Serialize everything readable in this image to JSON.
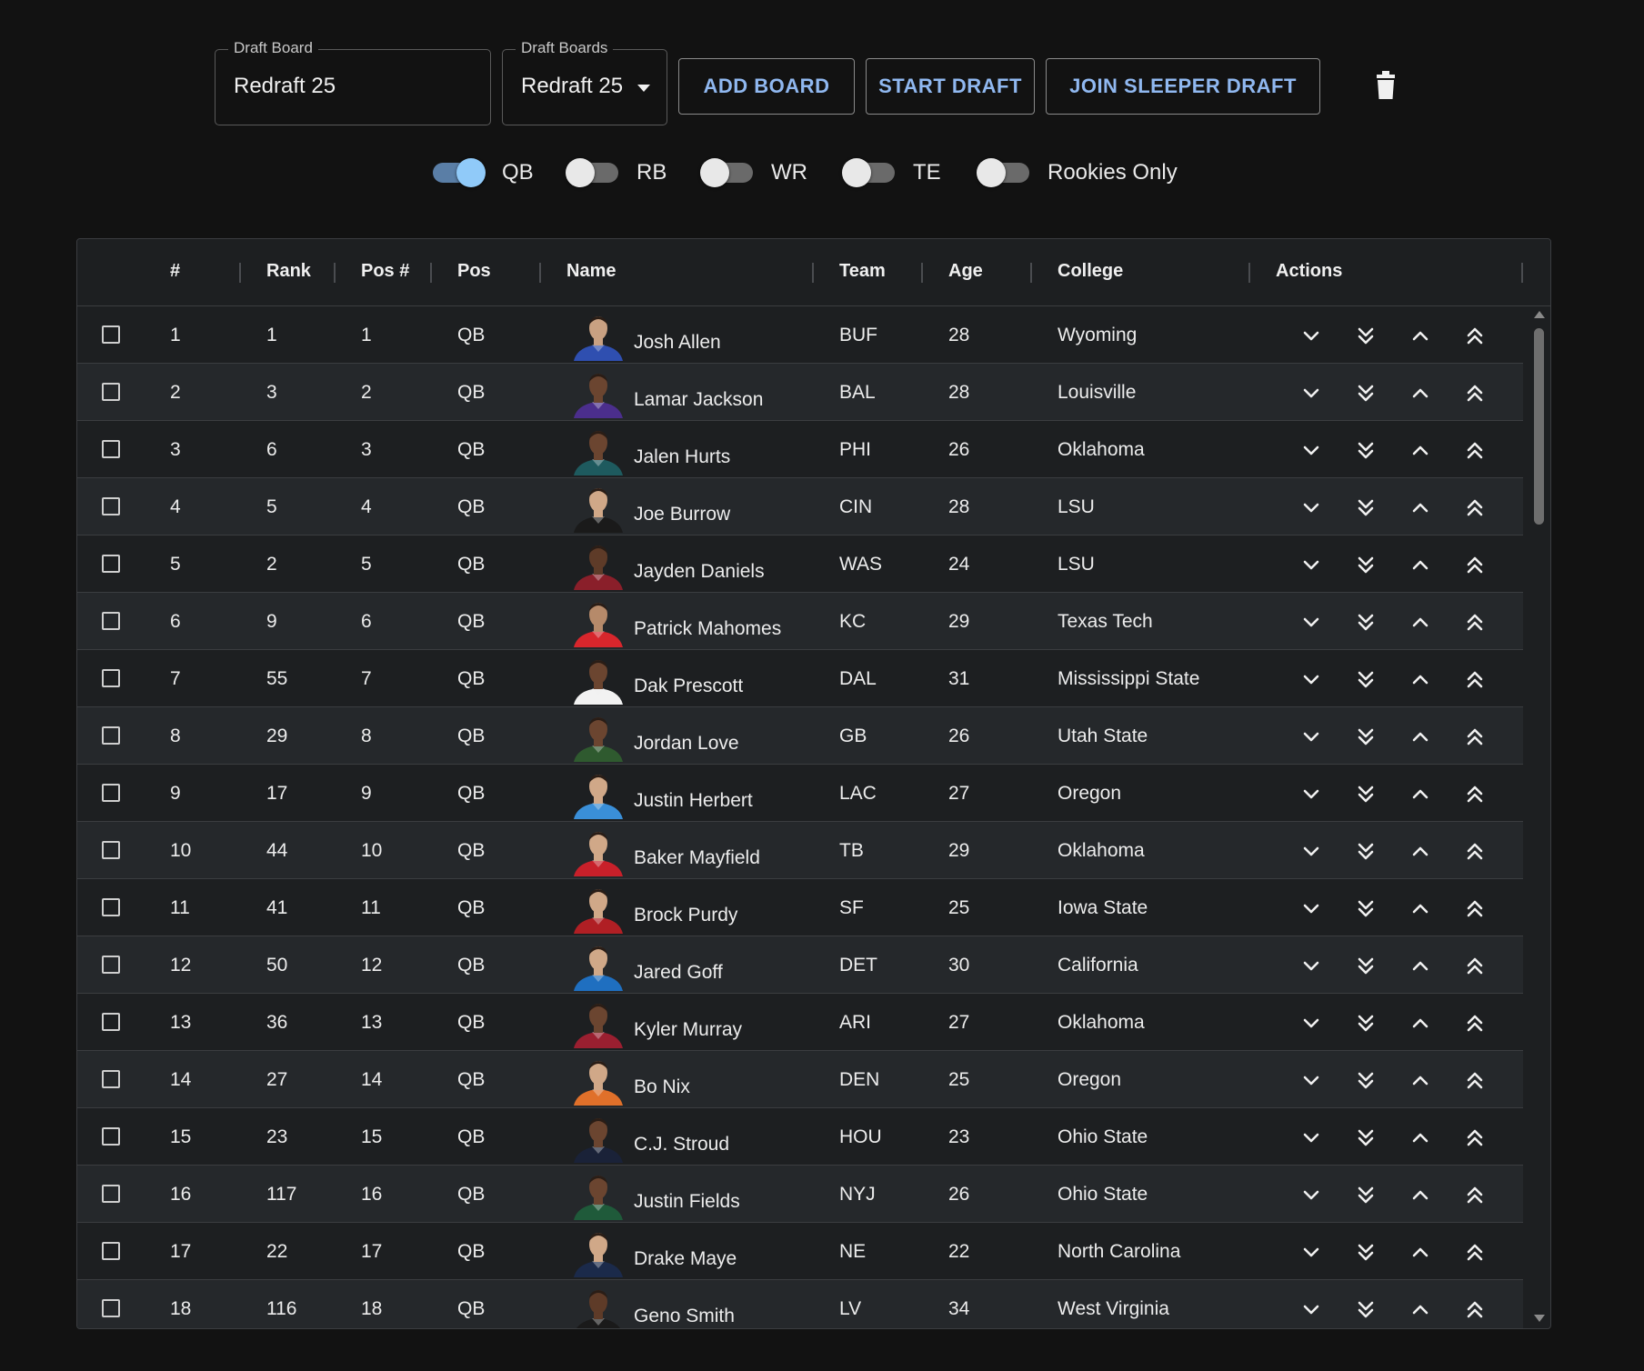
{
  "toolbar": {
    "draft_board_legend": "Draft Board",
    "draft_board_value": "Redraft 25",
    "draft_boards_legend": "Draft Boards",
    "draft_boards_value": "Redraft 25",
    "add_board_label": "ADD BOARD",
    "start_draft_label": "START DRAFT",
    "join_sleeper_label": "JOIN SLEEPER DRAFT",
    "delete_icon": "trash-icon"
  },
  "filters": [
    {
      "label": "QB",
      "on": true
    },
    {
      "label": "RB",
      "on": false
    },
    {
      "label": "WR",
      "on": false
    },
    {
      "label": "TE",
      "on": false
    },
    {
      "label": "Rookies Only",
      "on": false
    }
  ],
  "table": {
    "headers": {
      "num": "#",
      "rank": "Rank",
      "posnum": "Pos #",
      "pos": "Pos",
      "name": "Name",
      "team": "Team",
      "age": "Age",
      "college": "College",
      "actions": "Actions"
    },
    "action_icons": [
      "chevron-down-icon",
      "double-chevron-down-icon",
      "chevron-up-icon",
      "double-chevron-up-icon"
    ],
    "rows": [
      {
        "num": "1",
        "rank": "1",
        "posnum": "1",
        "pos": "QB",
        "name": "Josh Allen",
        "team": "BUF",
        "age": "28",
        "college": "Wyoming",
        "jersey": "#2f4fb0",
        "skin": "#c9a182"
      },
      {
        "num": "2",
        "rank": "3",
        "posnum": "2",
        "pos": "QB",
        "name": "Lamar Jackson",
        "team": "BAL",
        "age": "28",
        "college": "Louisville",
        "jersey": "#4b2e8c",
        "skin": "#6b4530"
      },
      {
        "num": "3",
        "rank": "6",
        "posnum": "3",
        "pos": "QB",
        "name": "Jalen Hurts",
        "team": "PHI",
        "age": "26",
        "college": "Oklahoma",
        "jersey": "#1e5a5e",
        "skin": "#6b4530"
      },
      {
        "num": "4",
        "rank": "5",
        "posnum": "4",
        "pos": "QB",
        "name": "Joe Burrow",
        "team": "CIN",
        "age": "28",
        "college": "LSU",
        "jersey": "#1a1a1a",
        "skin": "#d0a888"
      },
      {
        "num": "5",
        "rank": "2",
        "posnum": "5",
        "pos": "QB",
        "name": "Jayden Daniels",
        "team": "WAS",
        "age": "24",
        "college": "LSU",
        "jersey": "#8a1f2a",
        "skin": "#5e3b28"
      },
      {
        "num": "6",
        "rank": "9",
        "posnum": "6",
        "pos": "QB",
        "name": "Patrick Mahomes",
        "team": "KC",
        "age": "29",
        "college": "Texas Tech",
        "jersey": "#d8262c",
        "skin": "#b68a6a"
      },
      {
        "num": "7",
        "rank": "55",
        "posnum": "7",
        "pos": "QB",
        "name": "Dak Prescott",
        "team": "DAL",
        "age": "31",
        "college": "Mississippi State",
        "jersey": "#f2f2f2",
        "skin": "#6b4530"
      },
      {
        "num": "8",
        "rank": "29",
        "posnum": "8",
        "pos": "QB",
        "name": "Jordan Love",
        "team": "GB",
        "age": "26",
        "college": "Utah State",
        "jersey": "#2f5a2f",
        "skin": "#6b4530"
      },
      {
        "num": "9",
        "rank": "17",
        "posnum": "9",
        "pos": "QB",
        "name": "Justin Herbert",
        "team": "LAC",
        "age": "27",
        "college": "Oregon",
        "jersey": "#3a8fd8",
        "skin": "#d0a888"
      },
      {
        "num": "10",
        "rank": "44",
        "posnum": "10",
        "pos": "QB",
        "name": "Baker Mayfield",
        "team": "TB",
        "age": "29",
        "college": "Oklahoma",
        "jersey": "#c8202a",
        "skin": "#d0a888"
      },
      {
        "num": "11",
        "rank": "41",
        "posnum": "11",
        "pos": "QB",
        "name": "Brock Purdy",
        "team": "SF",
        "age": "25",
        "college": "Iowa State",
        "jersey": "#b01f24",
        "skin": "#d0a888"
      },
      {
        "num": "12",
        "rank": "50",
        "posnum": "12",
        "pos": "QB",
        "name": "Jared Goff",
        "team": "DET",
        "age": "30",
        "college": "California",
        "jersey": "#1f6fc0",
        "skin": "#d0a888"
      },
      {
        "num": "13",
        "rank": "36",
        "posnum": "13",
        "pos": "QB",
        "name": "Kyler Murray",
        "team": "ARI",
        "age": "27",
        "college": "Oklahoma",
        "jersey": "#9a1f30",
        "skin": "#6b4530"
      },
      {
        "num": "14",
        "rank": "27",
        "posnum": "14",
        "pos": "QB",
        "name": "Bo Nix",
        "team": "DEN",
        "age": "25",
        "college": "Oregon",
        "jersey": "#e0702a",
        "skin": "#d0a888"
      },
      {
        "num": "15",
        "rank": "23",
        "posnum": "15",
        "pos": "QB",
        "name": "C.J. Stroud",
        "team": "HOU",
        "age": "23",
        "college": "Ohio State",
        "jersey": "#1a2238",
        "skin": "#6b4530"
      },
      {
        "num": "16",
        "rank": "117",
        "posnum": "16",
        "pos": "QB",
        "name": "Justin Fields",
        "team": "NYJ",
        "age": "26",
        "college": "Ohio State",
        "jersey": "#1f5a3a",
        "skin": "#6b4530"
      },
      {
        "num": "17",
        "rank": "22",
        "posnum": "17",
        "pos": "QB",
        "name": "Drake Maye",
        "team": "NE",
        "age": "22",
        "college": "North Carolina",
        "jersey": "#1b2a4a",
        "skin": "#d0a888"
      },
      {
        "num": "18",
        "rank": "116",
        "posnum": "18",
        "pos": "QB",
        "name": "Geno Smith",
        "team": "LV",
        "age": "34",
        "college": "West Virginia",
        "jersey": "#1a1a1a",
        "skin": "#5e3b28"
      }
    ]
  }
}
